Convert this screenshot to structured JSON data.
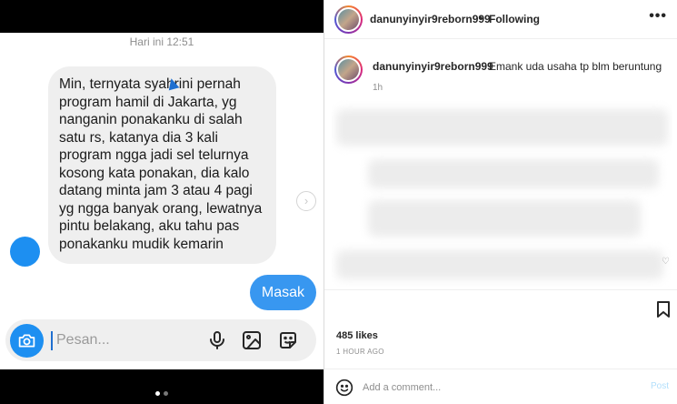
{
  "chat": {
    "timestamp": "Hari ini 12:51",
    "received_message": "Min, ternyata syahrini pernah program hamil di Jakarta, yg nanganin ponakanku di salah satu rs, katanya dia 3 kali program ngga jadi sel telurnya kosong kata ponakan, dia kalo datang minta jam 3 atau 4 pagi yg ngga banyak orang, lewatnya pintu belakang, aku tahu pas ponakanku mudik kemarin",
    "sent_message": "Masak",
    "composer": {
      "placeholder": "Pesan...",
      "camera_icon": "camera-icon",
      "mic_icon": "microphone-icon",
      "gallery_icon": "image-icon",
      "sticker_icon": "sticker-icon"
    },
    "accent_color": "#3897f0",
    "page_indicator": {
      "count": 2,
      "active": 0
    }
  },
  "post": {
    "header": {
      "username": "danunyinyir9reborn999",
      "separator": "•",
      "follow_status": "Following",
      "more_icon": "more-options-icon"
    },
    "comment": {
      "username": "danunyinyir9reborn999",
      "text": "Emank uda usaha tp blm beruntung",
      "time": "1h"
    },
    "likes": "485 likes",
    "posted_time": "1 HOUR AGO",
    "add_comment_placeholder": "Add a comment...",
    "post_button": "Post",
    "bookmark_icon": "bookmark-icon",
    "emoji_icon": "emoji-icon"
  }
}
